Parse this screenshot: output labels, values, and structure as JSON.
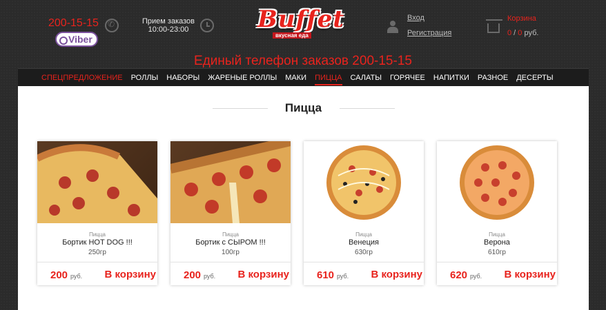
{
  "header": {
    "phone": "200-15-15",
    "viber_label": "Viber",
    "hours_title": "Прием заказов",
    "hours_value": "10:00-23:00",
    "logo_text": "Buffet",
    "logo_tagline": "вкусная еда",
    "login_label": "Вход",
    "register_label": "Регистрация",
    "cart_label": "Корзина",
    "cart_count": "0",
    "cart_separator": " / ",
    "cart_total": "0",
    "cart_currency": " руб."
  },
  "banner_phone": "Единый телефон заказов 200-15-15",
  "nav": {
    "items": [
      {
        "label": "СПЕЦПРЕДЛОЖЕНИЕ"
      },
      {
        "label": "РОЛЛЫ"
      },
      {
        "label": "НАБОРЫ"
      },
      {
        "label": "ЖАРЕНЫЕ РОЛЛЫ"
      },
      {
        "label": "МАКИ"
      },
      {
        "label": "ПИЦЦА"
      },
      {
        "label": "САЛАТЫ"
      },
      {
        "label": "ГОРЯЧЕЕ"
      },
      {
        "label": "НАПИТКИ"
      },
      {
        "label": "РАЗНОЕ"
      },
      {
        "label": "ДЕСЕРТЫ"
      }
    ]
  },
  "section_title": "Пицца",
  "products": [
    {
      "category": "Пицца",
      "name": "Бортик HOT DOG !!!",
      "weight": "250гр",
      "price": "200",
      "currency": "руб.",
      "button": "В корзину"
    },
    {
      "category": "Пицца",
      "name": "Бортик с СЫРОМ !!!",
      "weight": "100гр",
      "price": "200",
      "currency": "руб.",
      "button": "В корзину"
    },
    {
      "category": "Пицца",
      "name": "Венеция",
      "weight": "630гр",
      "price": "610",
      "currency": "руб.",
      "button": "В корзину"
    },
    {
      "category": "Пицца",
      "name": "Верона",
      "weight": "610гр",
      "price": "620",
      "currency": "руб.",
      "button": "В корзину"
    }
  ],
  "colors": {
    "accent": "#e8231d",
    "background": "#2b2b2b",
    "nav": "#1c1c1c",
    "viber": "#7b519d"
  }
}
